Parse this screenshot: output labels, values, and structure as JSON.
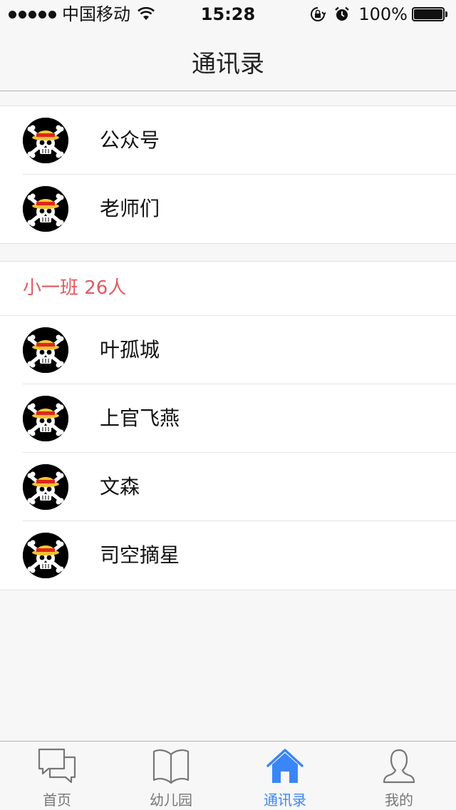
{
  "status_bar": {
    "carrier": "中国移动",
    "time": "15:28",
    "battery": "100%"
  },
  "nav": {
    "title": "通讯录"
  },
  "top_group": [
    {
      "label": "公众号",
      "icon": "skull-avatar-icon"
    },
    {
      "label": "老师们",
      "icon": "skull-avatar-icon"
    }
  ],
  "class_section": {
    "header": "小一班 26人",
    "header_color": "#e25a5f",
    "members": [
      {
        "label": "叶孤城",
        "icon": "skull-avatar-icon"
      },
      {
        "label": "上官飞燕",
        "icon": "skull-avatar-icon"
      },
      {
        "label": "文森",
        "icon": "skull-avatar-icon"
      },
      {
        "label": "司空摘星",
        "icon": "skull-avatar-icon"
      }
    ]
  },
  "tabbar": {
    "active_color": "#3a86f7",
    "tabs": [
      {
        "label": "首页",
        "icon": "chat-bubbles-icon",
        "active": false
      },
      {
        "label": "幼儿园",
        "icon": "open-book-icon",
        "active": false
      },
      {
        "label": "通讯录",
        "icon": "house-icon",
        "active": true
      },
      {
        "label": "我的",
        "icon": "person-icon",
        "active": false
      }
    ]
  }
}
